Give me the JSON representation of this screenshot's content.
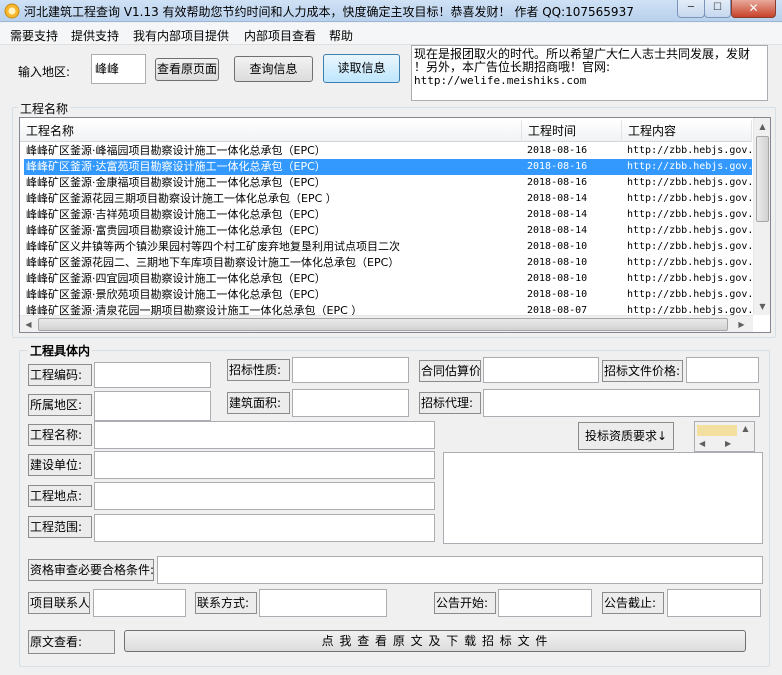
{
  "window": {
    "title": "河北建筑工程查询 V1.13  有效帮助您节约时间和人力成本，快度确定主攻目标！恭喜发财！ 作者 QQ:107565937",
    "minimize_glyph": "─",
    "maximize_glyph": "☐",
    "close_glyph": "✕"
  },
  "menu": {
    "items": [
      "需要支持",
      "提供支持",
      "我有内部项目提供",
      "内部项目查看",
      "帮助"
    ]
  },
  "search": {
    "region_label": "输入地区:",
    "region_value": "峰峰",
    "view_original_button": "查看原页面",
    "query_button": "查询信息",
    "read_button": "读取信息"
  },
  "ad": {
    "lines": [
      "现在是报团取火的时代。所以希望广大仁人志士共同发展，发财",
      "！另外，本广告位长期招商哦！官网:",
      "http://welife.meishiks.com"
    ]
  },
  "project_list": {
    "group_title": "工程名称",
    "columns": [
      "工程名称",
      "工程时间",
      "工程内容"
    ],
    "rows": [
      {
        "name": "峰峰矿区釜源·峰福园项目勘察设计施工一体化总承包（EPC）",
        "date": "2018-08-16",
        "url": "http://zbb.hebjs.gov.",
        "selected": false
      },
      {
        "name": "峰峰矿区釜源·达富苑项目勘察设计施工一体化总承包（EPC）",
        "date": "2018-08-16",
        "url": "http://zbb.hebjs.gov.",
        "selected": true
      },
      {
        "name": "峰峰矿区釜源·金康福项目勘察设计施工一体化总承包（EPC）",
        "date": "2018-08-16",
        "url": "http://zbb.hebjs.gov.",
        "selected": false
      },
      {
        "name": "峰峰矿区釜源花园三期项目勘察设计施工一体化总承包（EPC ）",
        "date": "2018-08-14",
        "url": "http://zbb.hebjs.gov.",
        "selected": false
      },
      {
        "name": "峰峰矿区釜源·吉祥苑项目勘察设计施工一体化总承包（EPC）",
        "date": "2018-08-14",
        "url": "http://zbb.hebjs.gov.",
        "selected": false
      },
      {
        "name": "峰峰矿区釜源·富贵园项目勘察设计施工一体化总承包（EPC）",
        "date": "2018-08-14",
        "url": "http://zbb.hebjs.gov.",
        "selected": false
      },
      {
        "name": "峰峰矿区义井镇等两个镇沙果园村等四个村工矿废弃地复垦利用试点项目二次",
        "date": "2018-08-10",
        "url": "http://zbb.hebjs.gov.",
        "selected": false
      },
      {
        "name": "峰峰矿区釜源花园二、三期地下车库项目勘察设计施工一体化总承包（EPC）",
        "date": "2018-08-10",
        "url": "http://zbb.hebjs.gov.",
        "selected": false
      },
      {
        "name": "峰峰矿区釜源·四宜园项目勘察设计施工一体化总承包（EPC）",
        "date": "2018-08-10",
        "url": "http://zbb.hebjs.gov.",
        "selected": false
      },
      {
        "name": "峰峰矿区釜源·景欣苑项目勘察设计施工一体化总承包（EPC）",
        "date": "2018-08-10",
        "url": "http://zbb.hebjs.gov.",
        "selected": false
      },
      {
        "name": "峰峰矿区釜源·清泉花园一期项目勘察设计施工一体化总承包（EPC ）",
        "date": "2018-08-07",
        "url": "http://zbb.hebjs.gov.",
        "selected": false
      }
    ]
  },
  "details": {
    "group_title": "工程具体内",
    "labels": {
      "code": "工程编码:",
      "tender_type": "招标性质:",
      "contract_estimate": "合同估算价",
      "tender_doc_price": "招标文件价格:",
      "region": "所属地区:",
      "building_area": "建筑面积:",
      "tender_agent": "招标代理:",
      "project_name": "工程名称:",
      "bid_requirements": "投标资质要求↓",
      "builder": "建设单位:",
      "location": "工程地点:",
      "scope": "工程范围:",
      "qualification": "资格审查必要合格条件:",
      "contact_person": "项目联系人",
      "contact_method": "联系方式:",
      "notice_start": "公告开始:",
      "notice_end": "公告截止:",
      "view_original": "原文查看:"
    },
    "download_button": "点 我 查 看 原 文 及 下 载 招 标 文 件"
  }
}
